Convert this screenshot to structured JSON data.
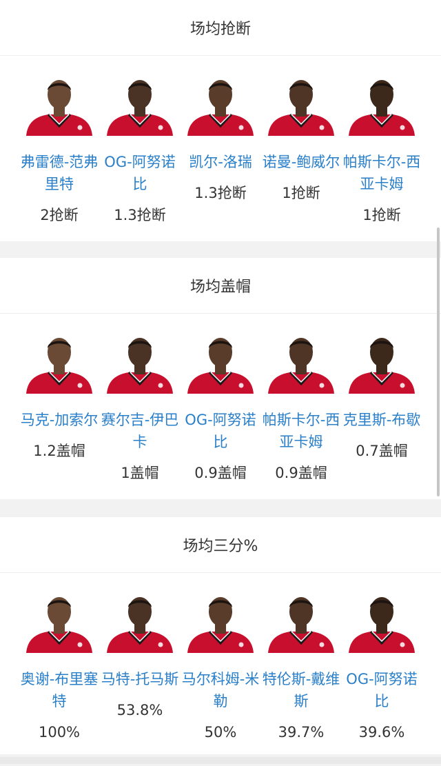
{
  "sections": [
    {
      "title": "场均抢断",
      "players": [
        {
          "name": "弗雷德-范弗\n里特",
          "value": "2抢断",
          "avatar": "player-photo"
        },
        {
          "name": "OG-阿努诺\n比",
          "value": "1.3抢断",
          "avatar": "player-photo"
        },
        {
          "name": "凯尔-洛瑞",
          "value": "1.3抢断",
          "avatar": "player-photo"
        },
        {
          "name": "诺曼-鲍威尔",
          "value": "1抢断",
          "avatar": "player-photo"
        },
        {
          "name": "帕斯卡尔-西\n亚卡姆",
          "value": "1抢断",
          "avatar": "player-photo"
        }
      ]
    },
    {
      "title": "场均盖帽",
      "players": [
        {
          "name": "马克-加索尔",
          "value": "1.2盖帽",
          "avatar": "player-photo"
        },
        {
          "name": "赛尔吉-伊巴\n卡",
          "value": "1盖帽",
          "avatar": "player-photo"
        },
        {
          "name": "OG-阿努诺\n比",
          "value": "0.9盖帽",
          "avatar": "player-photo"
        },
        {
          "name": "帕斯卡尔-西\n亚卡姆",
          "value": "0.9盖帽",
          "avatar": "player-photo"
        },
        {
          "name": "克里斯-布歇",
          "value": "0.7盖帽",
          "avatar": "player-photo"
        }
      ]
    },
    {
      "title": "场均三分%",
      "players": [
        {
          "name": "奥谢-布里塞\n特",
          "value": "100%",
          "avatar": "player-photo"
        },
        {
          "name": "马特-托马斯",
          "value": "53.8%",
          "avatar": "player-photo"
        },
        {
          "name": "马尔科姆-米\n勒",
          "value": "50%",
          "avatar": "player-photo"
        },
        {
          "name": "特伦斯-戴维\n斯",
          "value": "39.7%",
          "avatar": "player-photo"
        },
        {
          "name": "OG-阿努诺\n比",
          "value": "39.6%",
          "avatar": "player-photo"
        }
      ]
    }
  ],
  "colors": {
    "name_link": "#2a7fc9",
    "value_text": "#333333",
    "jersey": "#c8102e",
    "background": "#f2f2f2"
  }
}
